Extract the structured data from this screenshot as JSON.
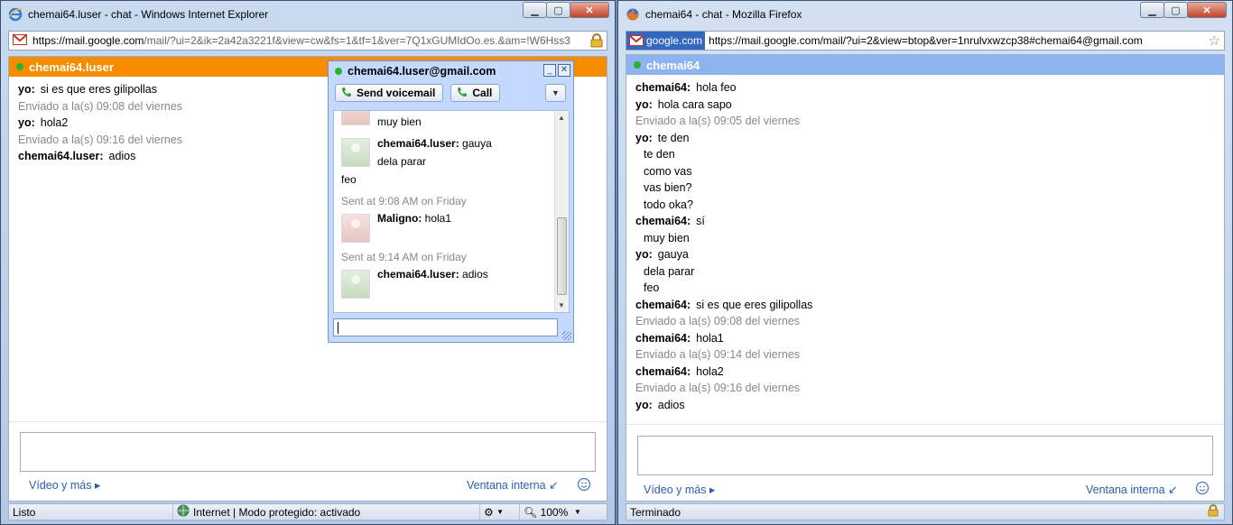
{
  "ie": {
    "title": "chemai64.luser - chat - Windows Internet Explorer",
    "address_host": "https://mail.google.com",
    "address_path": "/mail/?ui=2&ik=2a42a3221f&view=cw&fs=1&tf=1&ver=7Q1xGUMIdOo.es.&am=!W6Hss3",
    "chat_header": "chemai64.luser",
    "messages": [
      {
        "who": "yo:",
        "text": "si es que eres gilipollas"
      },
      {
        "stamp": "Enviado a la(s) 09:08 del viernes"
      },
      {
        "who": "yo:",
        "text": "hola2"
      },
      {
        "stamp": "Enviado a la(s) 09:16 del viernes"
      },
      {
        "who": "chemai64.luser:",
        "text": "adios"
      }
    ],
    "video_link": "Vídeo y más ▸",
    "ventana_link": "Ventana interna",
    "status": {
      "left": "Listo",
      "zone": "Internet | Modo protegido: activado",
      "zoom": "100%"
    }
  },
  "popout": {
    "title": "chemai64.luser@gmail.com",
    "voicemail_label": "Send voicemail",
    "call_label": "Call",
    "messages": {
      "m1": "muy bien",
      "m2_who": "chemai64.luser:",
      "m2_text": " gauya",
      "m3": "dela parar",
      "m4": "feo",
      "m5": "Sent at 9:08 AM on Friday",
      "m6_who": "Maligno:",
      "m6_text": " hola1",
      "m7": "Sent at 9:14 AM on Friday",
      "m8_who": "chemai64.luser:",
      "m8_text": " adios"
    }
  },
  "ff": {
    "title": "chemai64 - chat - Mozilla Firefox",
    "site_badge": "google.com",
    "address": "https://mail.google.com/mail/?ui=2&view=btop&ver=1nrulvxwzcp38#chemai64@gmail.com",
    "chat_header": "chemai64",
    "messages": [
      {
        "who": "chemai64:",
        "text": "hola feo"
      },
      {
        "who": "yo:",
        "text": "hola cara sapo"
      },
      {
        "stamp": "Enviado a la(s) 09:05 del viernes"
      },
      {
        "who": "yo:",
        "text": "te den"
      },
      {
        "cont": "te den"
      },
      {
        "cont": "como vas"
      },
      {
        "cont": "vas bien?"
      },
      {
        "cont": "todo oka?"
      },
      {
        "who": "chemai64:",
        "text": "sí"
      },
      {
        "cont": "muy bien"
      },
      {
        "who": "yo:",
        "text": "gauya"
      },
      {
        "cont": "dela parar"
      },
      {
        "cont": "feo"
      },
      {
        "who": "chemai64:",
        "text": "si es que eres gilipollas"
      },
      {
        "stamp": "Enviado a la(s) 09:08 del viernes"
      },
      {
        "who": "chemai64:",
        "text": "hola1"
      },
      {
        "stamp": "Enviado a la(s) 09:14 del viernes"
      },
      {
        "who": "chemai64:",
        "text": "hola2"
      },
      {
        "stamp": "Enviado a la(s) 09:16 del viernes"
      },
      {
        "who": "yo:",
        "text": "adios"
      }
    ],
    "video_link": "Vídeo y más ▸",
    "ventana_link": "Ventana interna",
    "status": "Terminado"
  },
  "colors": {
    "ie_header": "#f58c00",
    "ff_header": "#8eb4f0",
    "online_dot": "#2bb22b",
    "link": "#2a5db0"
  }
}
